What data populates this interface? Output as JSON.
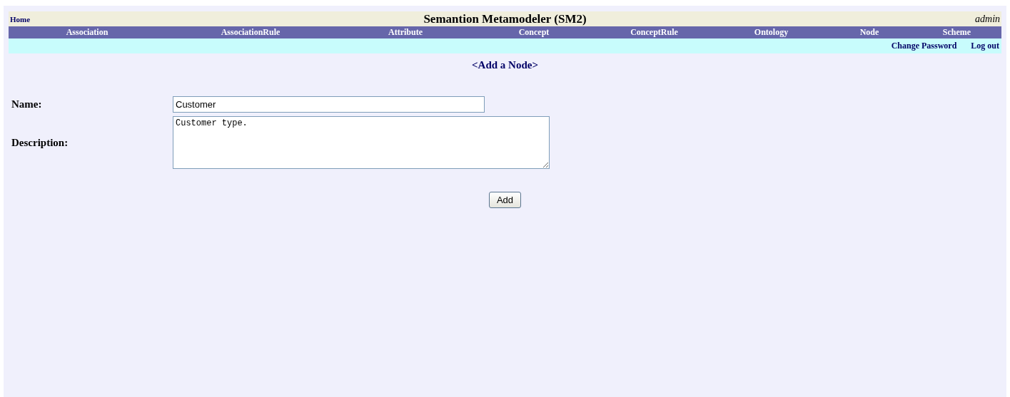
{
  "header": {
    "home_link": "Home",
    "title": "Semantion Metamodeler (SM2)",
    "user": "admin"
  },
  "nav": [
    {
      "label": "Association"
    },
    {
      "label": "AssociationRule"
    },
    {
      "label": "Attribute"
    },
    {
      "label": "Concept"
    },
    {
      "label": "ConceptRule"
    },
    {
      "label": "Ontology"
    },
    {
      "label": "Node"
    },
    {
      "label": "Scheme"
    }
  ],
  "account_links": [
    "Change Password",
    "Log out"
  ],
  "page_heading": "<Add a Node>",
  "form": {
    "fields": [
      {
        "kind": "input",
        "label": "Name:",
        "value": "Customer"
      },
      {
        "kind": "textarea",
        "label": "Description:",
        "value": "Customer type."
      }
    ],
    "submit": "Add"
  }
}
